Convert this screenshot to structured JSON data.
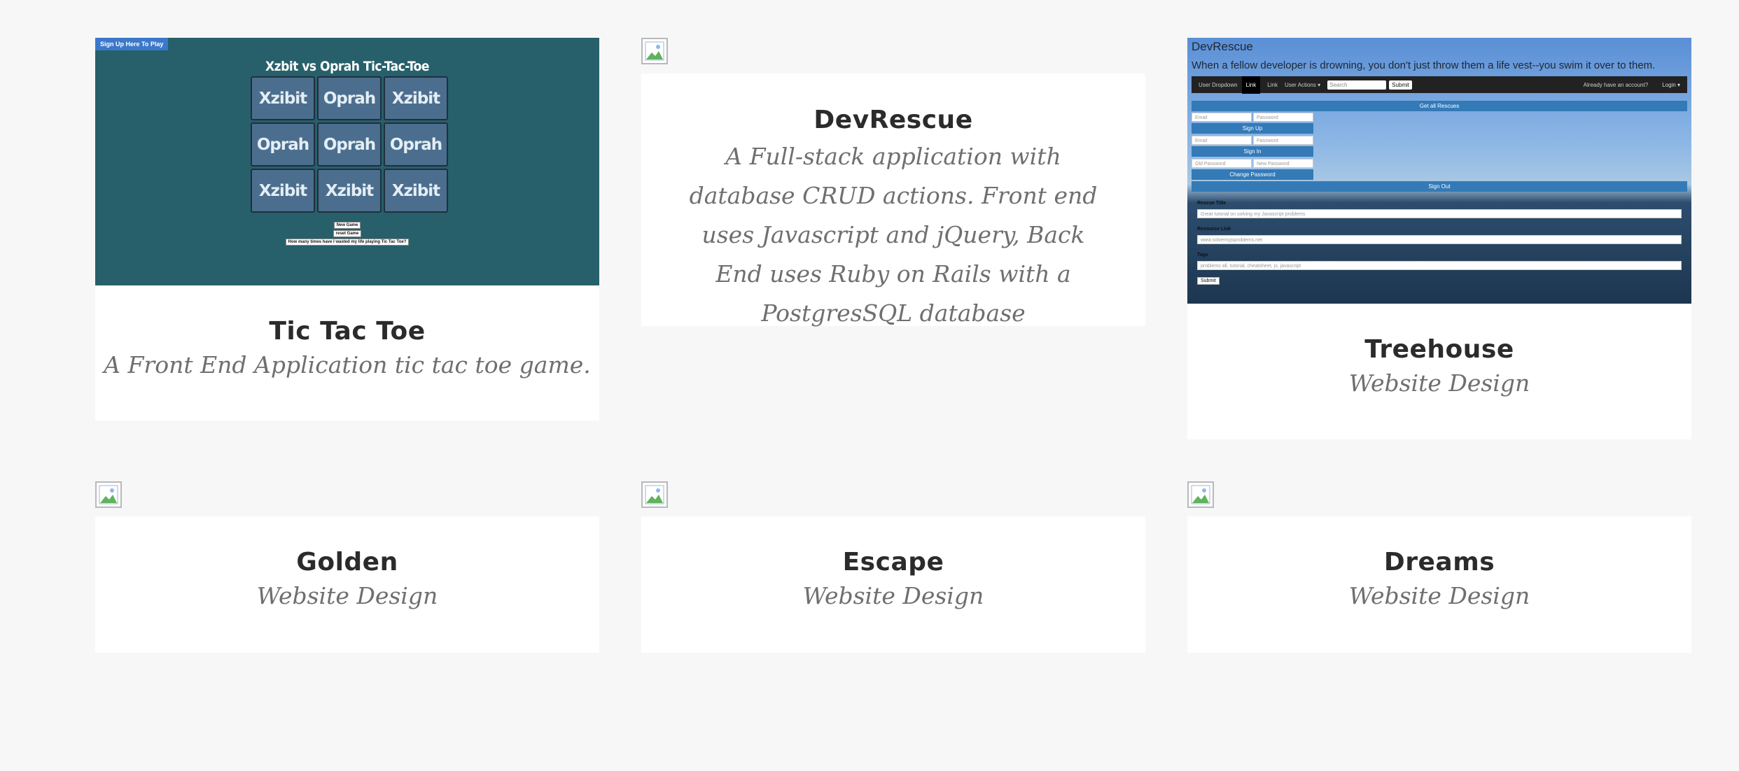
{
  "projects": [
    {
      "title": "Tic Tac Toe",
      "subtitle": "A Front End Application tic tac toe game.",
      "image_alt": "Tic Tac Toe screenshot",
      "preview": {
        "signup": "Sign Up Here To Play",
        "heading": "Xzbit vs Oprah Tic-Tac-Toe",
        "cells": [
          "Xzibit",
          "Oprah",
          "Xzibit",
          "Oprah",
          "Oprah",
          "Oprah",
          "Xzibit",
          "Xzibit",
          "Xzibit"
        ],
        "new_game": "New Game",
        "reset_game": "reset Game",
        "wasted": "How many times have I wasted my life playing Tic Tac Toe?"
      }
    },
    {
      "title": "DevRescue",
      "subtitle": "A Full-stack application with database CRUD actions. Front end uses Javascript and jQuery, Back End uses Ruby on Rails with a PostgresSQL database",
      "image_alt": "DevRescue image"
    },
    {
      "title": "Treehouse",
      "subtitle": "Website Design",
      "image_alt": "Treehouse screenshot",
      "preview": {
        "app_title": "DevRescue",
        "tagline": "When a fellow developer is drowning, you don't just throw them a life vest--you swim it over to them.",
        "nav_dropdown": "User Dropdown",
        "nav_link_active": "Link",
        "nav_link": "Link",
        "nav_actions": "User Actions ▾",
        "search_placeholder": "Search",
        "search_submit": "Submit",
        "account_text": "Already have an account?",
        "login": "Login ▾",
        "get_all": "Get all Rescues",
        "email": "Email",
        "password": "Password",
        "sign_up": "Sign Up",
        "sign_in": "Sign In",
        "old_password": "Old Password",
        "new_password": "New Password",
        "change_password": "Change Password",
        "sign_out": "Sign Out",
        "rescue_title_label": "Rescue Title",
        "rescue_title_value": "Great tutorial on solving my Javascript problems",
        "resource_link_label": "Resource Link",
        "resource_link_value": "www.solvemyjsproblems.net",
        "tags_label": "Tags",
        "tags_value": "problems all, tutorial, cheatsheet, js, javascript",
        "submit": "Submit"
      }
    },
    {
      "title": "Golden",
      "subtitle": "Website Design",
      "image_alt": "Golden image"
    },
    {
      "title": "Escape",
      "subtitle": "Website Design",
      "image_alt": "Escape image"
    },
    {
      "title": "Dreams",
      "subtitle": "Website Design",
      "image_alt": "Dreams image"
    }
  ]
}
